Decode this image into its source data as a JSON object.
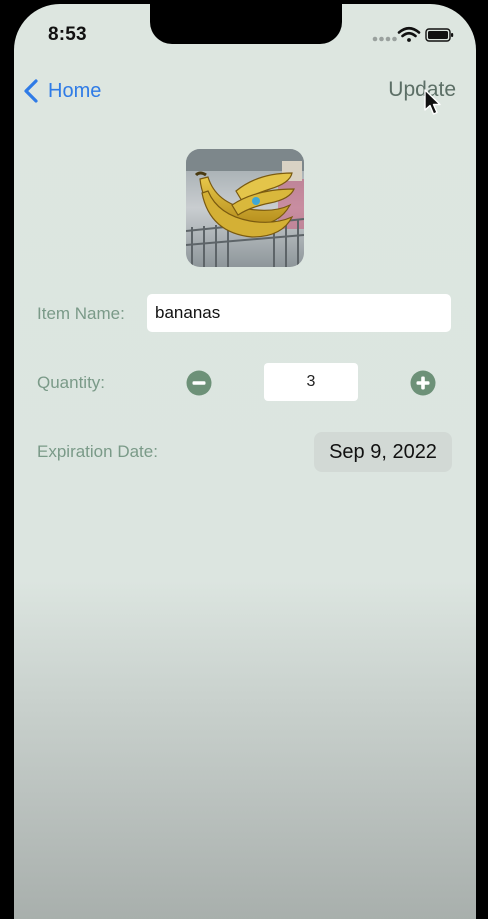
{
  "status_bar": {
    "time": "8:53",
    "icons": [
      "signal-dots-icon",
      "wifi-icon",
      "battery-icon"
    ]
  },
  "nav": {
    "back_label": "Home",
    "action_label": "Update"
  },
  "item": {
    "photo": "bananas-photo",
    "name_label": "Item Name:",
    "name_value": "bananas",
    "quantity_label": "Quantity:",
    "quantity_value": "3",
    "expiration_label": "Expiration Date:",
    "expiration_value": "Sep 9, 2022"
  },
  "colors": {
    "accent_blue": "#2f7be6",
    "label_green": "#7a9a88",
    "stepper_green": "#6d9178",
    "background": "#dde6e0"
  }
}
